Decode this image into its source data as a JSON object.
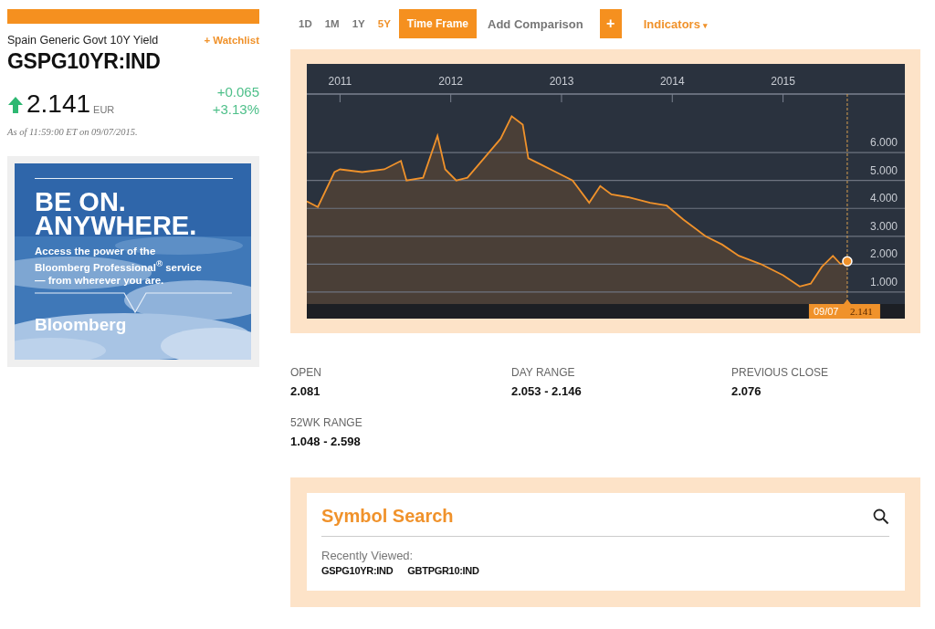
{
  "quote": {
    "name": "Spain Generic Govt 10Y Yield",
    "watchlist": "+ Watchlist",
    "ticker": "GSPG10YR:IND",
    "rising": true,
    "price": "2.141",
    "currency": "EUR",
    "change": "+0.065",
    "change_pct": "+3.13%",
    "timestamp": "As of 11:59:00 ET on 09/07/2015."
  },
  "ad": {
    "headline_1": "BE ON.",
    "headline_2": "ANYWHERE.",
    "body": "Access the power of the Bloomberg Professional$^{®}$ service — from wherever you are.",
    "brand": "Bloomberg"
  },
  "toolbar": {
    "ranges": [
      {
        "label": "1D",
        "selected": false
      },
      {
        "label": "1M",
        "selected": false
      },
      {
        "label": "1Y",
        "selected": false
      },
      {
        "label": "5Y",
        "selected": true
      }
    ],
    "time_frame": "Time Frame",
    "add_comparison": "Add Comparison",
    "add": "+",
    "indicators": "Indicators",
    "indicators_caret": "▾"
  },
  "chart": {
    "chart_data": {
      "type": "area",
      "x": [
        2010.7,
        2010.8,
        2010.95,
        2011.0,
        2011.2,
        2011.4,
        2011.55,
        2011.6,
        2011.75,
        2011.88,
        2011.95,
        2012.05,
        2012.15,
        2012.3,
        2012.45,
        2012.55,
        2012.65,
        2012.7,
        2012.8,
        2012.95,
        2013.1,
        2013.25,
        2013.35,
        2013.45,
        2013.6,
        2013.8,
        2013.95,
        2014.1,
        2014.3,
        2014.45,
        2014.6,
        2014.8,
        2015.0,
        2015.15,
        2015.25,
        2015.35,
        2015.45,
        2015.52,
        2015.58
      ],
      "grid": true,
      "ref_lines": [
        {
          "axis": "x",
          "value": 2015.58
        }
      ],
      "series": [
        {
          "color": "#f0922b",
          "values": [
            4.25,
            4.05,
            5.3,
            5.4,
            5.3,
            5.4,
            5.7,
            5.0,
            5.1,
            6.6,
            5.4,
            5.0,
            5.1,
            5.8,
            6.5,
            7.3,
            7.0,
            5.8,
            5.6,
            5.3,
            5.0,
            4.2,
            4.8,
            4.5,
            4.4,
            4.2,
            4.1,
            3.6,
            3.0,
            2.7,
            2.3,
            2.0,
            1.6,
            1.2,
            1.3,
            1.9,
            2.3,
            2.0,
            2.1
          ]
        }
      ],
      "xlim": [
        2010.7,
        2016.1
      ],
      "ylim": [
        0.57,
        8.1
      ],
      "xticks": [
        {
          "value": 2011,
          "label": "2011"
        },
        {
          "value": 2012,
          "label": "2012"
        },
        {
          "value": 2013,
          "label": "2013"
        },
        {
          "value": 2014,
          "label": "2014"
        },
        {
          "value": 2015,
          "label": "2015"
        }
      ],
      "yticks": [
        {
          "value": 1,
          "label": "1.000"
        },
        {
          "value": 2,
          "label": "2.000"
        },
        {
          "value": 3,
          "label": "3.000"
        },
        {
          "value": 4,
          "label": "4.000"
        },
        {
          "value": 5,
          "label": "5.000"
        },
        {
          "value": 6,
          "label": "6.000"
        }
      ]
    },
    "marker": {
      "date": "09/07",
      "value": "2.141"
    }
  },
  "stats": [
    {
      "label": "OPEN",
      "value": "2.081"
    },
    {
      "label": "DAY RANGE",
      "value": "2.053 - 2.146"
    },
    {
      "label": "PREVIOUS CLOSE",
      "value": "2.076"
    },
    {
      "label": "52WK RANGE",
      "value": "1.048 - 2.598"
    }
  ],
  "symbol_search": {
    "title": "Symbol Search",
    "recent_label": "Recently Viewed:",
    "recent": [
      "GSPG10YR:IND",
      "GBTPGR10:IND"
    ]
  }
}
